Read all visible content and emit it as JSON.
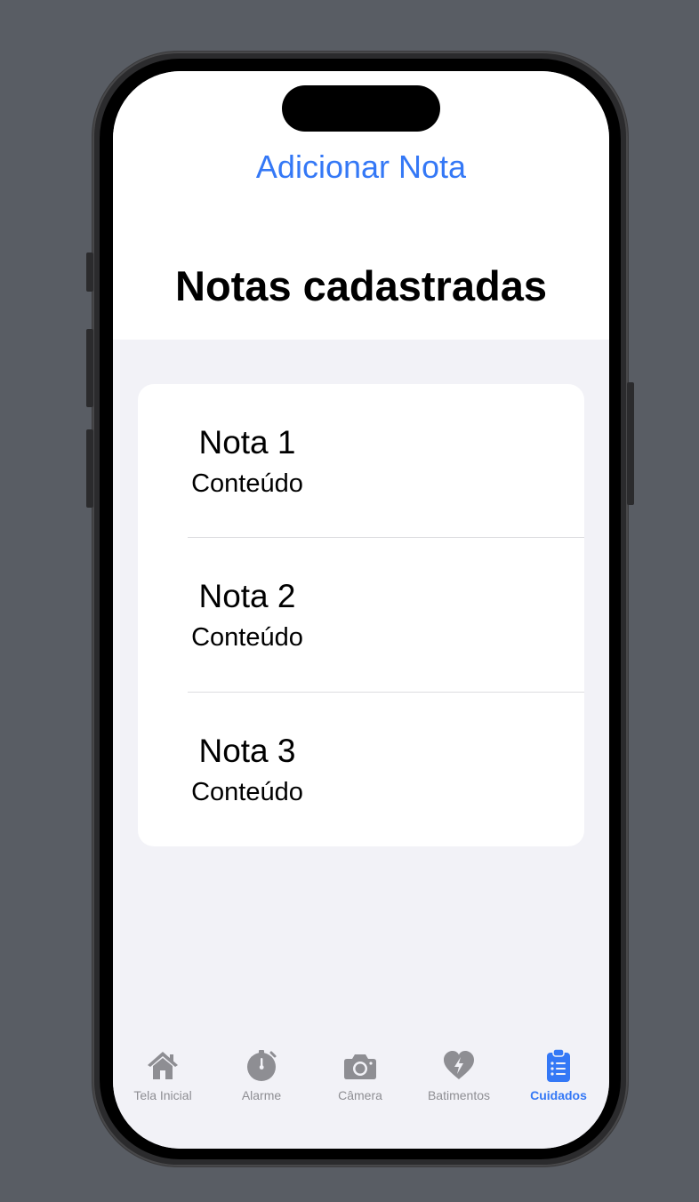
{
  "header": {
    "add_note_label": "Adicionar Nota",
    "title": "Notas cadastradas"
  },
  "notes": [
    {
      "title": "Nota 1",
      "content": "Conteúdo"
    },
    {
      "title": "Nota 2",
      "content": "Conteúdo"
    },
    {
      "title": "Nota 3",
      "content": "Conteúdo"
    }
  ],
  "tab_bar": {
    "items": [
      {
        "label": "Tela Inicial",
        "icon": "house-icon",
        "active": false
      },
      {
        "label": "Alarme",
        "icon": "timer-icon",
        "active": false
      },
      {
        "label": "Câmera",
        "icon": "camera-icon",
        "active": false
      },
      {
        "label": "Batimentos",
        "icon": "heart-bolt-icon",
        "active": false
      },
      {
        "label": "Cuidados",
        "icon": "clipboard-list-icon",
        "active": true
      }
    ]
  },
  "colors": {
    "accent": "#3478f6",
    "inactive": "#8e8e93",
    "screen_background": "#f2f2f7",
    "outer_background": "#595d64"
  }
}
